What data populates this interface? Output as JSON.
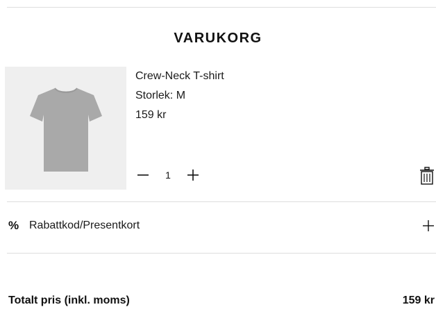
{
  "cart": {
    "title": "VARUKORG"
  },
  "item": {
    "name": "Crew-Neck T-shirt",
    "size": "Storlek: M",
    "price": "159 kr",
    "quantity": "1",
    "image_icon": "tshirt-image",
    "image_color": "#a9a9a9",
    "decrement_icon": "minus-icon",
    "increment_icon": "plus-icon",
    "remove_icon": "trash-icon"
  },
  "discount": {
    "icon": "%",
    "label": "Rabattkod/Presentkort",
    "expand_icon": "plus-icon"
  },
  "summary": {
    "total_label": "Totalt pris (inkl. moms)",
    "total_value": "159 kr"
  }
}
